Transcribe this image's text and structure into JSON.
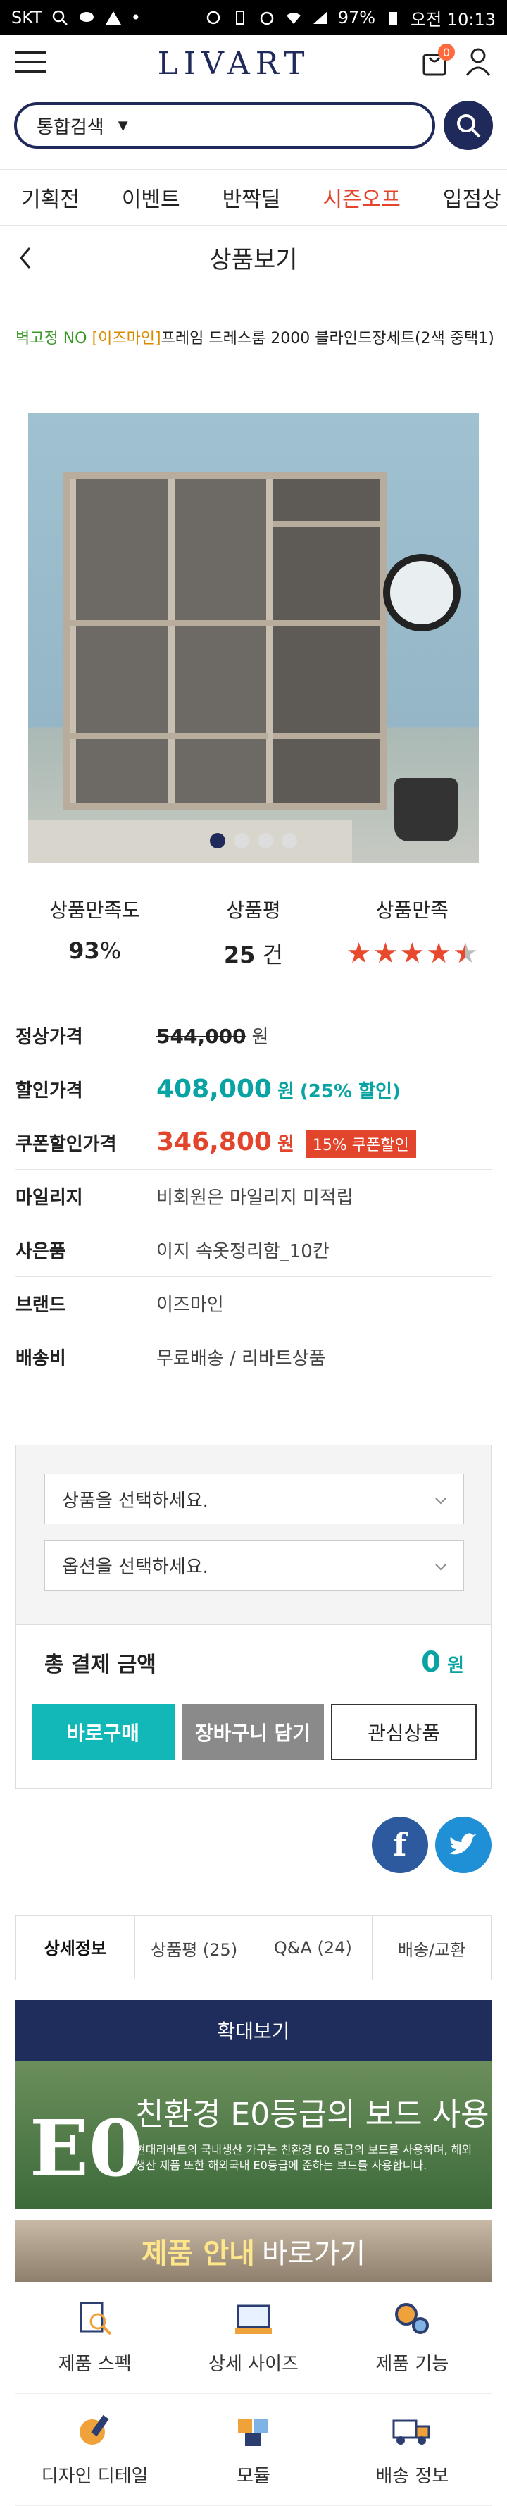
{
  "status_bar": {
    "carrier": "SKT",
    "battery": "97%",
    "time": "오전 10:13"
  },
  "header": {
    "logo": "LIVART",
    "cart_count": "0"
  },
  "search": {
    "scope": "통합검색"
  },
  "category_tabs": [
    {
      "label": "기획전"
    },
    {
      "label": "이벤트"
    },
    {
      "label": "반짝딜"
    },
    {
      "label": "시즌오프"
    },
    {
      "label": "입점상"
    }
  ],
  "page_title": "상품보기",
  "product": {
    "tag_wall": "벽고정 NO",
    "tag_brand": "[이즈마인]",
    "name": "프레임 드레스룸 2000 블라인드장세트(2색 중택1)"
  },
  "ratings": {
    "satisfaction_label": "상품만족도",
    "satisfaction_value": "93",
    "satisfaction_unit": "%",
    "reviews_label": "상품평",
    "reviews_value": "25",
    "reviews_unit": "건",
    "stars_label": "상품만족",
    "stars_value": 4.5
  },
  "price": {
    "regular_label": "정상가격",
    "regular_value": "544,000",
    "regular_unit": "원",
    "sale_label": "할인가격",
    "sale_value": "408,000",
    "sale_unit": "원",
    "sale_rate": "(25% 할인)",
    "coupon_label": "쿠폰할인가격",
    "coupon_value": "346,800",
    "coupon_unit": "원",
    "coupon_badge": "15% 쿠폰할인",
    "mileage_label": "마일리지",
    "mileage_value": "비회원은 마일리지 미적립",
    "gift_label": "사은품",
    "gift_value": "이지 속옷정리함_10칸",
    "brand_label": "브랜드",
    "brand_value": "이즈마인",
    "shipping_label": "배송비",
    "shipping_value": "무료배송 / 리바트상품"
  },
  "options": {
    "product_select": "상품을 선택하세요.",
    "option_select": "옵션을 선택하세요.",
    "total_label": "총 결제 금액",
    "total_value": "0",
    "total_unit": "원",
    "buy_now": "바로구매",
    "add_cart": "장바구니 담기",
    "wishlist": "관심상품"
  },
  "detail_tabs": [
    {
      "label": "상세정보"
    },
    {
      "label": "상품평 (25)"
    },
    {
      "label": "Q&A (24)"
    },
    {
      "label": "배송/교환"
    }
  ],
  "detail": {
    "zoom_label": "확대보기",
    "eo_mark": "E0",
    "eo_title": "친환경 E0등급의 보드 사용",
    "eo_desc": "현대리바트의 국내생산 가구는 친환경 E0 등급의 보드를 사용하며, 해외 생산 제품 또한 해외국내 E0등급에 준하는 보드를 사용합니다.",
    "guide_highlight": "제품 안내",
    "guide_rest": "바로가기"
  },
  "quick_menu": [
    {
      "label": "제품 스펙",
      "icon": "magnifier-doc-icon"
    },
    {
      "label": "상세 사이즈",
      "icon": "ruler-icon"
    },
    {
      "label": "제품 기능",
      "icon": "gears-icon"
    },
    {
      "label": "디자인 디테일",
      "icon": "brush-icon"
    },
    {
      "label": "모듈",
      "icon": "puzzle-icon"
    },
    {
      "label": "배송 정보",
      "icon": "truck-icon"
    }
  ],
  "colors": {
    "navy": "#1f2a5a",
    "teal": "#0aa3a3",
    "red": "#e2452b"
  }
}
